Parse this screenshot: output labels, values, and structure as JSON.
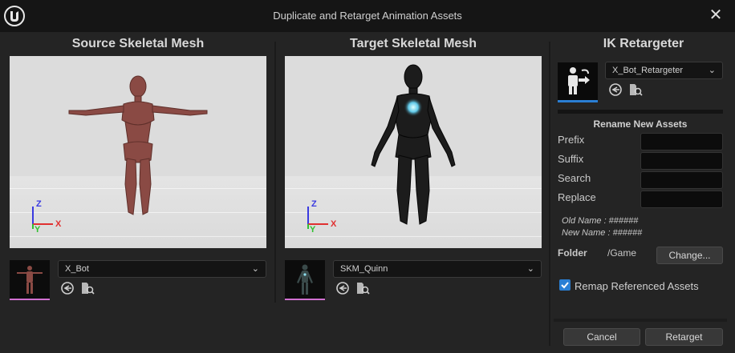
{
  "window": {
    "title": "Duplicate and Retarget Animation Assets",
    "close_glyph": "✕"
  },
  "source": {
    "title": "Source Skeletal Mesh",
    "mesh_name": "X_Bot",
    "axis_z": "Z",
    "axis_x": "X",
    "axis_y": "Y"
  },
  "target": {
    "title": "Target Skeletal Mesh",
    "mesh_name": "SKM_Quinn",
    "axis_z": "Z",
    "axis_x": "X",
    "axis_y": "Y"
  },
  "retargeter": {
    "title": "IK Retargeter",
    "asset_name": "X_Bot_Retargeter"
  },
  "rename": {
    "title": "Rename New Assets",
    "prefix_label": "Prefix",
    "suffix_label": "Suffix",
    "search_label": "Search",
    "replace_label": "Replace",
    "prefix_value": "",
    "suffix_value": "",
    "search_value": "",
    "replace_value": "",
    "old_name": "Old Name : ######",
    "new_name": "New Name : ######"
  },
  "folder": {
    "label": "Folder",
    "path": "/Game",
    "change_label": "Change..."
  },
  "remap": {
    "label": "Remap Referenced Assets",
    "checked": true
  },
  "footer": {
    "cancel_label": "Cancel",
    "retarget_label": "Retarget"
  },
  "colors": {
    "accent": "#2a7fd4",
    "thumb_underline": "#d070d0",
    "axis_z": "#3a3ae0",
    "axis_x": "#e03030",
    "axis_y": "#30c030"
  }
}
